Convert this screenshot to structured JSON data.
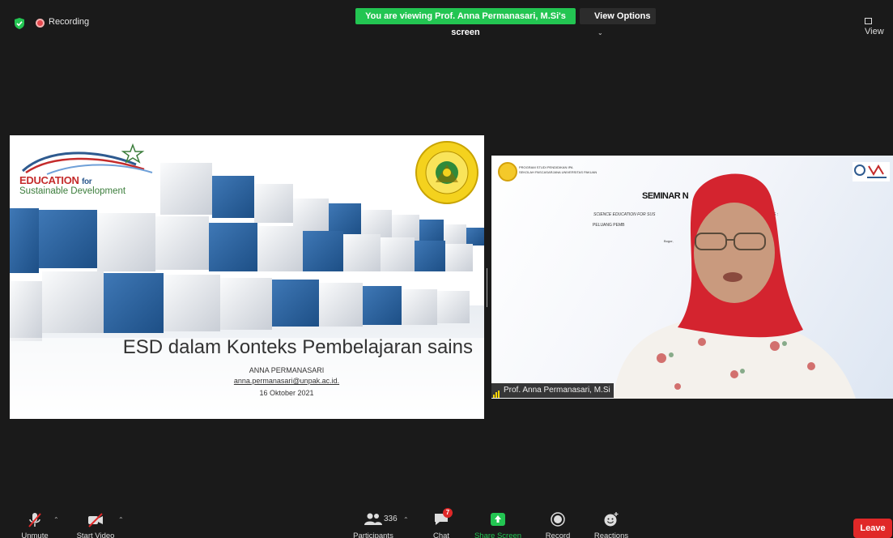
{
  "top_bar": {
    "recording_label": "Recording",
    "viewing_banner": "You are viewing Prof. Anna Permanasari, M.Si's screen",
    "view_options_label": "View Options",
    "view_label": "View"
  },
  "slide": {
    "logo_line1": "EDUCATION",
    "logo_for": "for",
    "logo_line2": "Sustainable Development",
    "title": "ESD dalam Konteks Pembelajaran sains",
    "author": "ANNA PERMANASARI",
    "email": "anna.permanasari@unpak.ac.id",
    "email_suffix": ".",
    "date": "16 Oktober 2021"
  },
  "video": {
    "program_line1": "PROGRAM STUDI PENDIDIKAN IPA",
    "program_line2": "SEKOLAH PASCASARJANA UNIVERSITAS PAKUAN",
    "seminar": "SEMINAR N",
    "science_line": "SCIENCE EDUCATION FOR SUS",
    "goals_fragment": "GOALS :",
    "peluang": "PELUANG PEMB",
    "bogor": "Bogor,",
    "participant_name": "Prof. Anna Permanasari, M.Si"
  },
  "toolbar": {
    "unmute": "Unmute",
    "start_video": "Start Video",
    "participants": "Participants",
    "participants_count": "336",
    "chat": "Chat",
    "chat_badge": "7",
    "share_screen": "Share Screen",
    "record": "Record",
    "reactions": "Reactions",
    "leave": "Leave"
  },
  "colors": {
    "banner_green": "#23c552",
    "leave_red": "#e02828",
    "background": "#1a1a1a"
  }
}
